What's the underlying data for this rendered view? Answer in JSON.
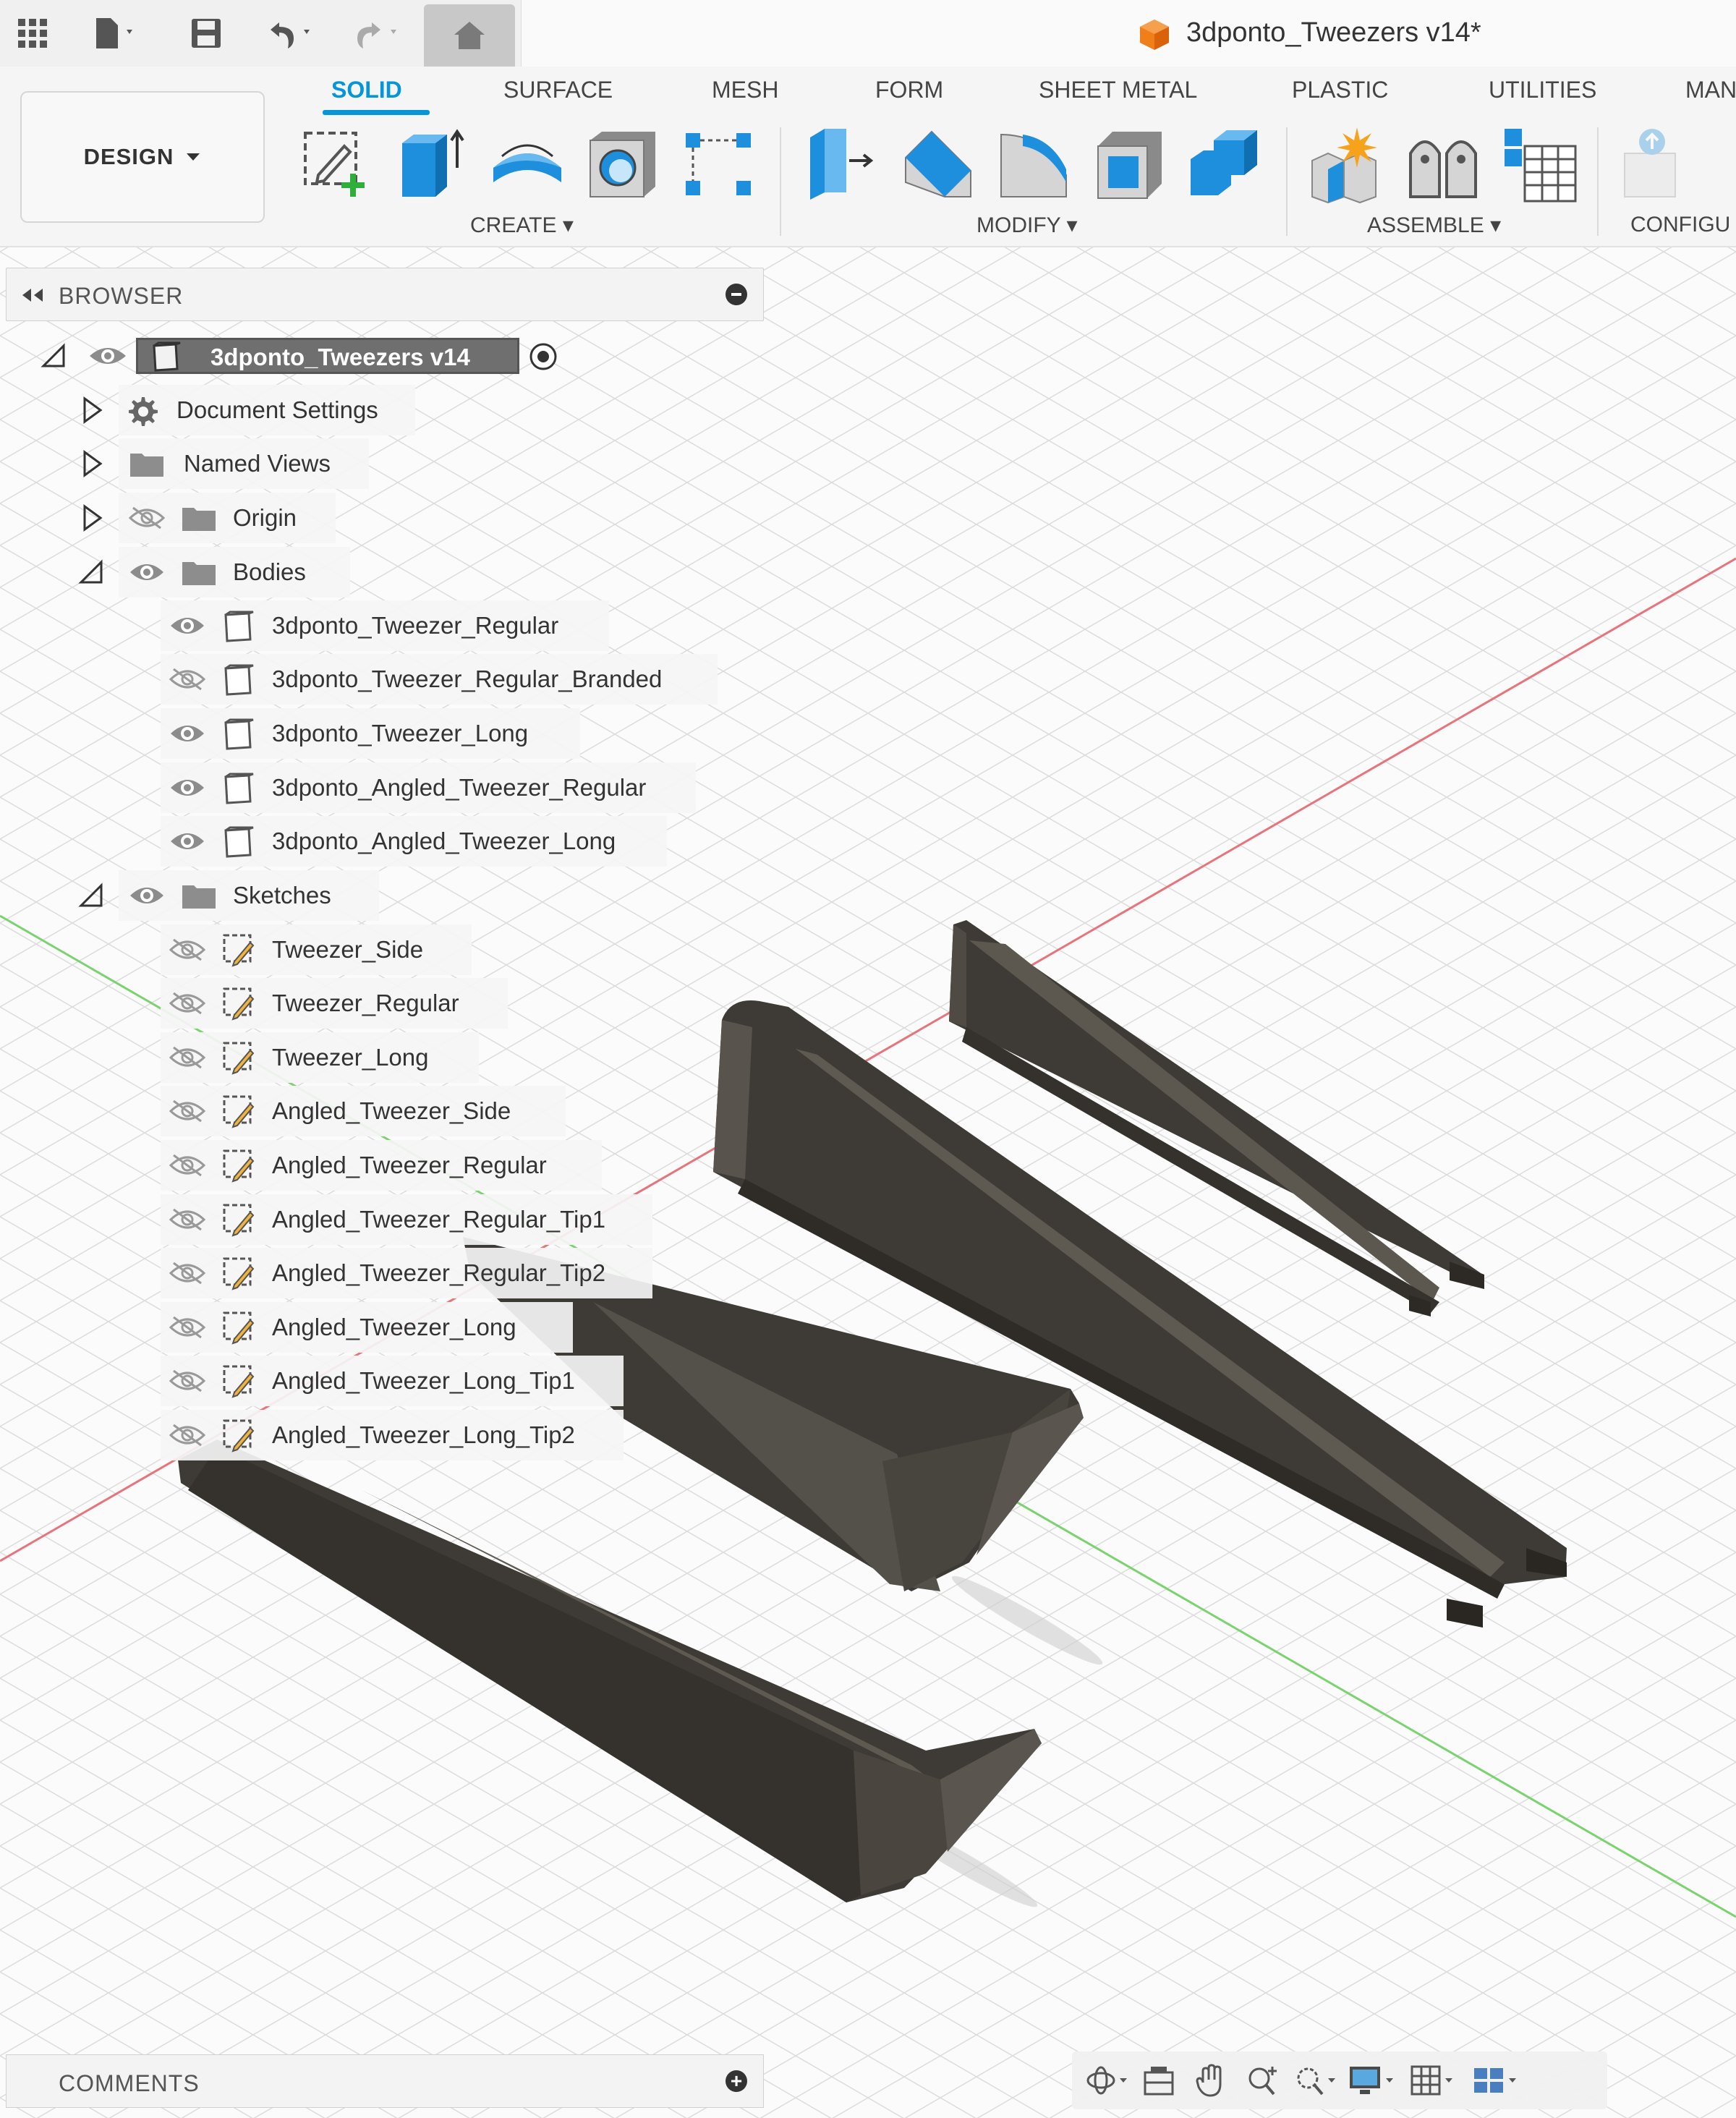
{
  "app": {
    "document_title": "3dponto_Tweezers v14*"
  },
  "ribbon": {
    "workspace_label": "DESIGN",
    "tabs": [
      "SOLID",
      "SURFACE",
      "MESH",
      "FORM",
      "SHEET METAL",
      "PLASTIC",
      "UTILITIES",
      "MAN"
    ],
    "active_tab": "SOLID",
    "groups": [
      "CREATE",
      "MODIFY",
      "ASSEMBLE",
      "CONFIGU"
    ]
  },
  "browser": {
    "header": "BROWSER",
    "root_label": "3dponto_Tweezers v14",
    "document_settings": "Document Settings",
    "named_views": "Named Views",
    "origin": "Origin",
    "bodies_folder": "Bodies",
    "bodies": [
      {
        "label": "3dponto_Tweezer_Regular",
        "visible": true
      },
      {
        "label": "3dponto_Tweezer_Regular_Branded",
        "visible": false
      },
      {
        "label": "3dponto_Tweezer_Long",
        "visible": true
      },
      {
        "label": "3dponto_Angled_Tweezer_Regular",
        "visible": true
      },
      {
        "label": "3dponto_Angled_Tweezer_Long",
        "visible": true
      }
    ],
    "sketches_folder": "Sketches",
    "sketches": [
      {
        "label": "Tweezer_Side",
        "visible": false
      },
      {
        "label": "Tweezer_Regular",
        "visible": false
      },
      {
        "label": "Tweezer_Long",
        "visible": false
      },
      {
        "label": "Angled_Tweezer_Side",
        "visible": false
      },
      {
        "label": "Angled_Tweezer_Regular",
        "visible": false
      },
      {
        "label": "Angled_Tweezer_Regular_Tip1",
        "visible": false
      },
      {
        "label": "Angled_Tweezer_Regular_Tip2",
        "visible": false
      },
      {
        "label": "Angled_Tweezer_Long",
        "visible": false
      },
      {
        "label": "Angled_Tweezer_Long_Tip1",
        "visible": false
      },
      {
        "label": "Angled_Tweezer_Long_Tip2",
        "visible": false
      }
    ]
  },
  "comments": {
    "label": "COMMENTS"
  },
  "colors": {
    "accent": "#0696d7",
    "x_axis": "#e8737a",
    "y_axis": "#7bd36f",
    "grid": "#d9d9d9",
    "model_dark": "#3e3b36",
    "model_face": "#58544d"
  },
  "icons": {
    "quick_access": [
      "apps-grid-icon",
      "file-icon",
      "save-icon",
      "undo-icon",
      "redo-icon",
      "home-icon"
    ],
    "create_tools": [
      "create-sketch-icon",
      "extrude-icon",
      "revolve-icon",
      "hole-icon",
      "pattern-icon"
    ],
    "modify_tools": [
      "press-pull-icon",
      "fillet-icon",
      "chamfer-icon",
      "shell-icon",
      "combine-icon"
    ],
    "assemble_tools": [
      "new-component-icon",
      "joint-icon",
      "table-icon"
    ],
    "nav_tools": [
      "orbit-icon",
      "look-at-icon",
      "pan-icon",
      "zoom-icon",
      "fit-icon",
      "display-settings-icon",
      "grid-icon",
      "viewports-icon"
    ]
  }
}
